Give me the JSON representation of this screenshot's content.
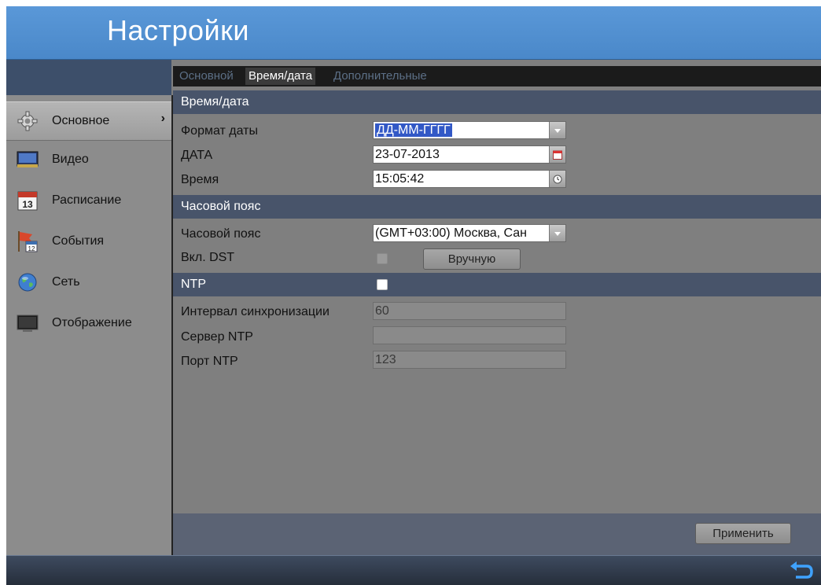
{
  "window": {
    "title": "Настройки"
  },
  "sidebar": {
    "items": [
      {
        "label": "Основное",
        "icon": "gear-icon",
        "active": true,
        "arrow": "›"
      },
      {
        "label": "Видео",
        "icon": "video-icon"
      },
      {
        "label": "Расписание",
        "icon": "calendar-icon",
        "icon_text": "13"
      },
      {
        "label": "События",
        "icon": "event-flag-icon",
        "icon_text": "12"
      },
      {
        "label": "Сеть",
        "icon": "globe-icon"
      },
      {
        "label": "Отображение",
        "icon": "monitor-icon"
      }
    ]
  },
  "tabs": [
    {
      "label": "Основной",
      "active": false
    },
    {
      "label": "Время/дата",
      "active": true
    },
    {
      "label": "Дополнительные",
      "active": false
    }
  ],
  "sections": {
    "datetime": "Время/дата",
    "timezone": "Часовой пояс",
    "ntp": "NTP"
  },
  "form": {
    "date_format": {
      "label": "Формат даты",
      "value": "ДД-ММ-ГГГГ"
    },
    "date": {
      "label": "ДАТА",
      "value": "23-07-2013"
    },
    "time": {
      "label": "Время",
      "value": "15:05:42"
    },
    "timezone": {
      "label": "Часовой пояс",
      "value": "(GMT+03:00) Москва, Сан"
    },
    "dst": {
      "label": "Вкл. DST",
      "checked": false,
      "manual_button": "Вручную"
    },
    "ntp": {
      "checked": false
    },
    "sync_interval": {
      "label": "Интервал синхронизации",
      "value": "60"
    },
    "ntp_server": {
      "label": "Сервер NTP",
      "value": ""
    },
    "ntp_port": {
      "label": "Порт NTP",
      "value": "123"
    }
  },
  "apply_button": "Применить",
  "colors": {
    "header": "#4a88c9",
    "section": "#48546a",
    "selection": "#3258c6"
  }
}
